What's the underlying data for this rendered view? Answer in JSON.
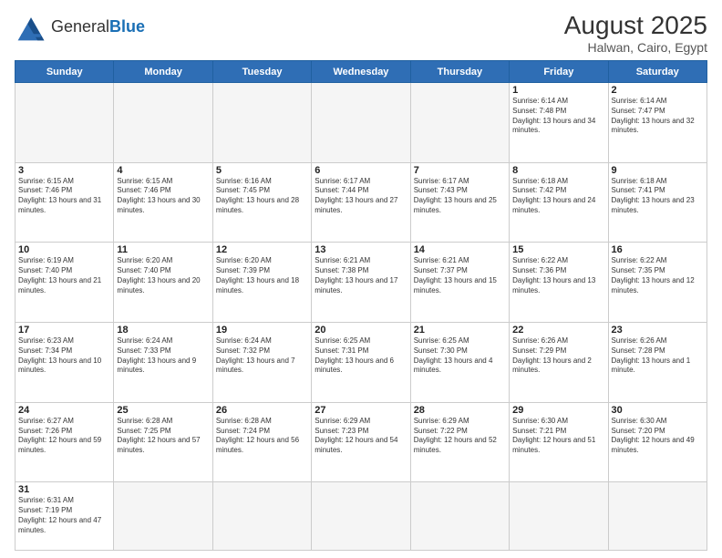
{
  "header": {
    "logo_general": "General",
    "logo_blue": "Blue",
    "month_year": "August 2025",
    "location": "Halwan, Cairo, Egypt"
  },
  "weekdays": [
    "Sunday",
    "Monday",
    "Tuesday",
    "Wednesday",
    "Thursday",
    "Friday",
    "Saturday"
  ],
  "weeks": [
    [
      {
        "day": "",
        "empty": true
      },
      {
        "day": "",
        "empty": true
      },
      {
        "day": "",
        "empty": true
      },
      {
        "day": "",
        "empty": true
      },
      {
        "day": "",
        "empty": true
      },
      {
        "day": "1",
        "sunrise": "6:14 AM",
        "sunset": "7:48 PM",
        "daylight": "13 hours and 34 minutes."
      },
      {
        "day": "2",
        "sunrise": "6:14 AM",
        "sunset": "7:47 PM",
        "daylight": "13 hours and 32 minutes."
      }
    ],
    [
      {
        "day": "3",
        "sunrise": "6:15 AM",
        "sunset": "7:46 PM",
        "daylight": "13 hours and 31 minutes."
      },
      {
        "day": "4",
        "sunrise": "6:15 AM",
        "sunset": "7:46 PM",
        "daylight": "13 hours and 30 minutes."
      },
      {
        "day": "5",
        "sunrise": "6:16 AM",
        "sunset": "7:45 PM",
        "daylight": "13 hours and 28 minutes."
      },
      {
        "day": "6",
        "sunrise": "6:17 AM",
        "sunset": "7:44 PM",
        "daylight": "13 hours and 27 minutes."
      },
      {
        "day": "7",
        "sunrise": "6:17 AM",
        "sunset": "7:43 PM",
        "daylight": "13 hours and 25 minutes."
      },
      {
        "day": "8",
        "sunrise": "6:18 AM",
        "sunset": "7:42 PM",
        "daylight": "13 hours and 24 minutes."
      },
      {
        "day": "9",
        "sunrise": "6:18 AM",
        "sunset": "7:41 PM",
        "daylight": "13 hours and 23 minutes."
      }
    ],
    [
      {
        "day": "10",
        "sunrise": "6:19 AM",
        "sunset": "7:40 PM",
        "daylight": "13 hours and 21 minutes."
      },
      {
        "day": "11",
        "sunrise": "6:20 AM",
        "sunset": "7:40 PM",
        "daylight": "13 hours and 20 minutes."
      },
      {
        "day": "12",
        "sunrise": "6:20 AM",
        "sunset": "7:39 PM",
        "daylight": "13 hours and 18 minutes."
      },
      {
        "day": "13",
        "sunrise": "6:21 AM",
        "sunset": "7:38 PM",
        "daylight": "13 hours and 17 minutes."
      },
      {
        "day": "14",
        "sunrise": "6:21 AM",
        "sunset": "7:37 PM",
        "daylight": "13 hours and 15 minutes."
      },
      {
        "day": "15",
        "sunrise": "6:22 AM",
        "sunset": "7:36 PM",
        "daylight": "13 hours and 13 minutes."
      },
      {
        "day": "16",
        "sunrise": "6:22 AM",
        "sunset": "7:35 PM",
        "daylight": "13 hours and 12 minutes."
      }
    ],
    [
      {
        "day": "17",
        "sunrise": "6:23 AM",
        "sunset": "7:34 PM",
        "daylight": "13 hours and 10 minutes."
      },
      {
        "day": "18",
        "sunrise": "6:24 AM",
        "sunset": "7:33 PM",
        "daylight": "13 hours and 9 minutes."
      },
      {
        "day": "19",
        "sunrise": "6:24 AM",
        "sunset": "7:32 PM",
        "daylight": "13 hours and 7 minutes."
      },
      {
        "day": "20",
        "sunrise": "6:25 AM",
        "sunset": "7:31 PM",
        "daylight": "13 hours and 6 minutes."
      },
      {
        "day": "21",
        "sunrise": "6:25 AM",
        "sunset": "7:30 PM",
        "daylight": "13 hours and 4 minutes."
      },
      {
        "day": "22",
        "sunrise": "6:26 AM",
        "sunset": "7:29 PM",
        "daylight": "13 hours and 2 minutes."
      },
      {
        "day": "23",
        "sunrise": "6:26 AM",
        "sunset": "7:28 PM",
        "daylight": "13 hours and 1 minute."
      }
    ],
    [
      {
        "day": "24",
        "sunrise": "6:27 AM",
        "sunset": "7:26 PM",
        "daylight": "12 hours and 59 minutes."
      },
      {
        "day": "25",
        "sunrise": "6:28 AM",
        "sunset": "7:25 PM",
        "daylight": "12 hours and 57 minutes."
      },
      {
        "day": "26",
        "sunrise": "6:28 AM",
        "sunset": "7:24 PM",
        "daylight": "12 hours and 56 minutes."
      },
      {
        "day": "27",
        "sunrise": "6:29 AM",
        "sunset": "7:23 PM",
        "daylight": "12 hours and 54 minutes."
      },
      {
        "day": "28",
        "sunrise": "6:29 AM",
        "sunset": "7:22 PM",
        "daylight": "12 hours and 52 minutes."
      },
      {
        "day": "29",
        "sunrise": "6:30 AM",
        "sunset": "7:21 PM",
        "daylight": "12 hours and 51 minutes."
      },
      {
        "day": "30",
        "sunrise": "6:30 AM",
        "sunset": "7:20 PM",
        "daylight": "12 hours and 49 minutes."
      }
    ],
    [
      {
        "day": "31",
        "sunrise": "6:31 AM",
        "sunset": "7:19 PM",
        "daylight": "12 hours and 47 minutes.",
        "last": true
      },
      {
        "day": "",
        "empty": true,
        "last": true
      },
      {
        "day": "",
        "empty": true,
        "last": true
      },
      {
        "day": "",
        "empty": true,
        "last": true
      },
      {
        "day": "",
        "empty": true,
        "last": true
      },
      {
        "day": "",
        "empty": true,
        "last": true
      },
      {
        "day": "",
        "empty": true,
        "last": true
      }
    ]
  ]
}
